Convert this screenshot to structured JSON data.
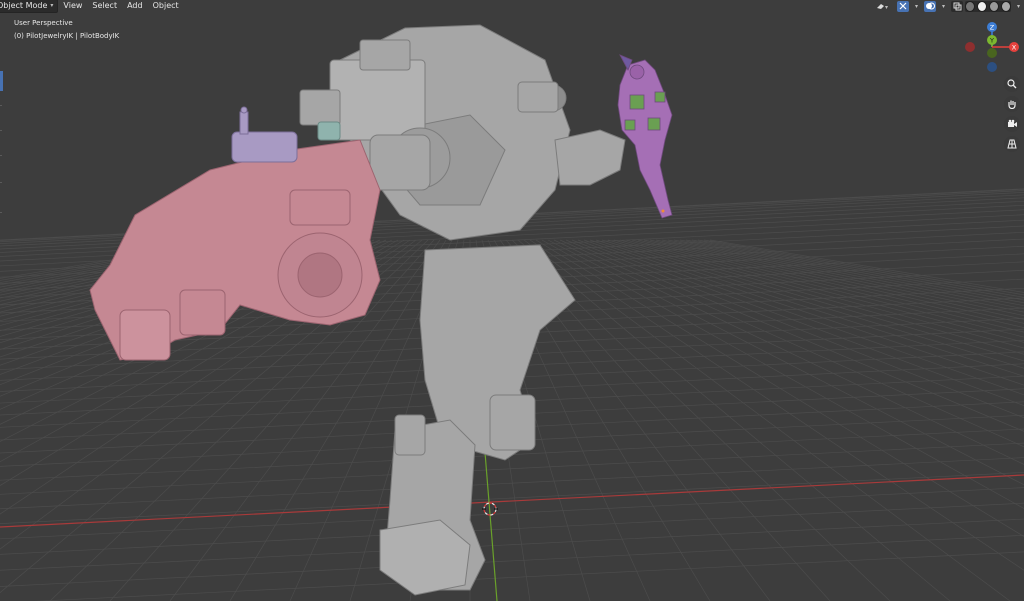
{
  "header": {
    "mode_label": "Object Mode",
    "menus": [
      "View",
      "Select",
      "Add",
      "Object"
    ]
  },
  "viewport": {
    "perspective_label": "User Perspective",
    "collection_label": "(0) PilotJewelryIK | PilotBodyIK"
  },
  "gizmo": {
    "z_label": "Z",
    "y_label": "Y",
    "x_label": "X",
    "colors": {
      "x_axis": "#e6413d",
      "y_axis": "#7cb82f",
      "z_axis": "#3d7ed6"
    }
  },
  "navigation": {
    "zoom_icon": "zoom-icon",
    "pan_icon": "hand-icon",
    "camera_icon": "camera-icon",
    "grid_icon": "grid-view-icon"
  },
  "toolbar_right": {
    "icons": [
      "view-object-types-icon",
      "gizmo-icon",
      "overlays-icon",
      "xray-icon",
      "wireframe-shading-icon",
      "solid-shading-icon",
      "material-shading-icon",
      "rendered-shading-icon"
    ]
  },
  "scene": {
    "colors": {
      "background": "#3d3d3d",
      "grid": "#4a4a4a",
      "x_axis_line": "#a83a3a",
      "y_axis_line": "#6aa12a",
      "mech": "#a9a9a9",
      "weapon": "#c58a96",
      "pilot": "#a672b3"
    }
  }
}
